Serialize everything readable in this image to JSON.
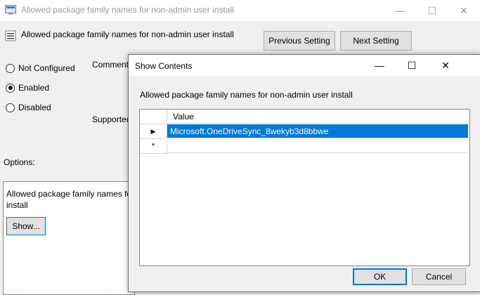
{
  "background_window": {
    "title": "Allowed package family names for non-admin user install",
    "setting_name": "Allowed package family names for non-admin user install",
    "previous_setting": "Previous Setting",
    "next_setting": "Next Setting",
    "radio_options": [
      {
        "label": "Not Configured",
        "selected": false
      },
      {
        "label": "Enabled",
        "selected": true
      },
      {
        "label": "Disabled",
        "selected": false
      }
    ],
    "comment_label": "Comment",
    "supported_label": "Supported",
    "options_label": "Options:",
    "options_text_line1": "Allowed package family names fo",
    "options_text_line2": "install",
    "show_button": "Show..."
  },
  "dialog": {
    "title": "Show Contents",
    "description": "Allowed package family names for non-admin user install",
    "grid": {
      "column_header": "Value",
      "rows": [
        {
          "marker": "▶",
          "value": "Microsoft.OneDriveSync_8wekyb3d8bbwe",
          "selected": true
        },
        {
          "marker": "*",
          "value": "",
          "selected": false
        }
      ]
    },
    "ok_label": "OK",
    "cancel_label": "Cancel"
  },
  "colors": {
    "selection": "#0078d7",
    "window_bg": "#f0f0f0"
  }
}
